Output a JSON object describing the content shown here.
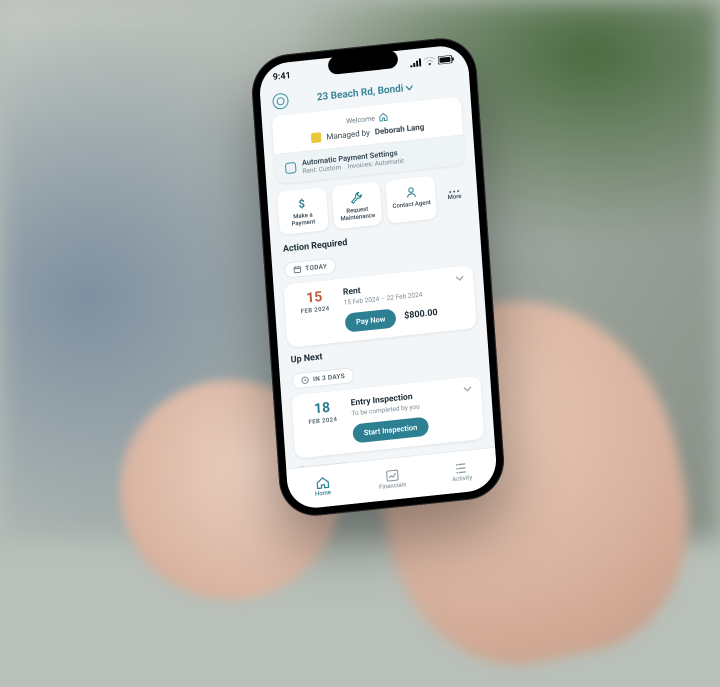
{
  "status": {
    "time": "9:41"
  },
  "address": "23 Beach Rd, Bondi",
  "welcome_label": "Welcome",
  "managed": {
    "prefix": "Managed by",
    "agent": "Deborah Lang"
  },
  "payment_settings": {
    "title": "Automatic Payment Settings",
    "rent": "Rent: Custom",
    "invoices": "Invoices: Automatic"
  },
  "quick_actions": {
    "pay": "Make a Payment",
    "maint": "Request Maintenance",
    "contact": "Contact Agent",
    "more": "More"
  },
  "action_required": {
    "heading": "Action Required",
    "chip": "TODAY",
    "day": "15",
    "month": "FEB 2024",
    "title": "Rent",
    "range": "15 Feb 2024 – 22 Feb 2024",
    "cta": "Pay Now",
    "amount": "$800.00"
  },
  "up_next": {
    "heading": "Up Next",
    "chip": "IN 3 DAYS",
    "day": "18",
    "month": "FEB 2024",
    "title": "Entry Inspection",
    "sub": "To be completed by you",
    "cta": "Start Inspection"
  },
  "reported_label": "REPORTED",
  "tabs": {
    "home": "Home",
    "financials": "Financials",
    "activity": "Activity"
  }
}
